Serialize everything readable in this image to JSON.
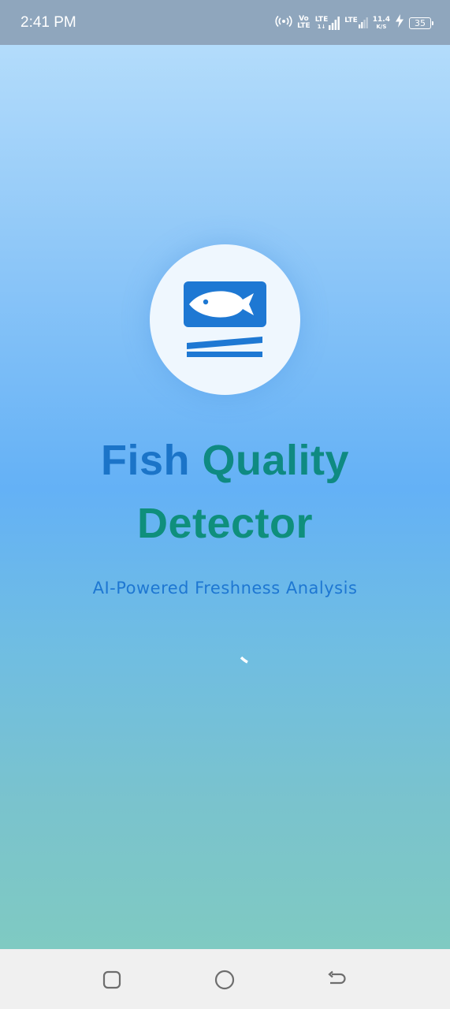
{
  "status_bar": {
    "time": "2:41 PM",
    "volte_top": "Vo",
    "volte_bottom": "LTE",
    "sim1_network": "LTE",
    "sim1_sub": "1↓",
    "sim2_network": "LTE",
    "data_rate": "11.4",
    "data_unit": "K/S",
    "battery_level": "35",
    "icons": [
      "hotspot-icon",
      "volte-icon",
      "signal-sim1-icon",
      "signal-sim2-icon",
      "charging-bolt-icon",
      "battery-icon"
    ]
  },
  "splash": {
    "logo_icon": "fish-logo-icon",
    "title_line_1_part_1": "Fish",
    "title_line_1_part_2": "Quality",
    "title_line_2": "Detector",
    "subtitle": "AI-Powered Freshness Analysis",
    "loading_indicator": "spinner"
  },
  "colors": {
    "status_bar_bg": "#8fa6bd",
    "gradient_top": "#b3dcfb",
    "gradient_middle": "#64b1f6",
    "gradient_bottom": "#7fcac2",
    "title_blue": "#1b74c8",
    "title_teal": "#0f8f7c",
    "subtitle": "#1e77d2",
    "logo_bg": "#eff7fe",
    "logo_icon": "#1e78d3",
    "nav_bar_bg": "#f0f0f0",
    "nav_icon": "#6d6d6d"
  },
  "nav_bar": {
    "icons": [
      "recents-square-icon",
      "home-circle-icon",
      "back-arrow-icon"
    ]
  }
}
